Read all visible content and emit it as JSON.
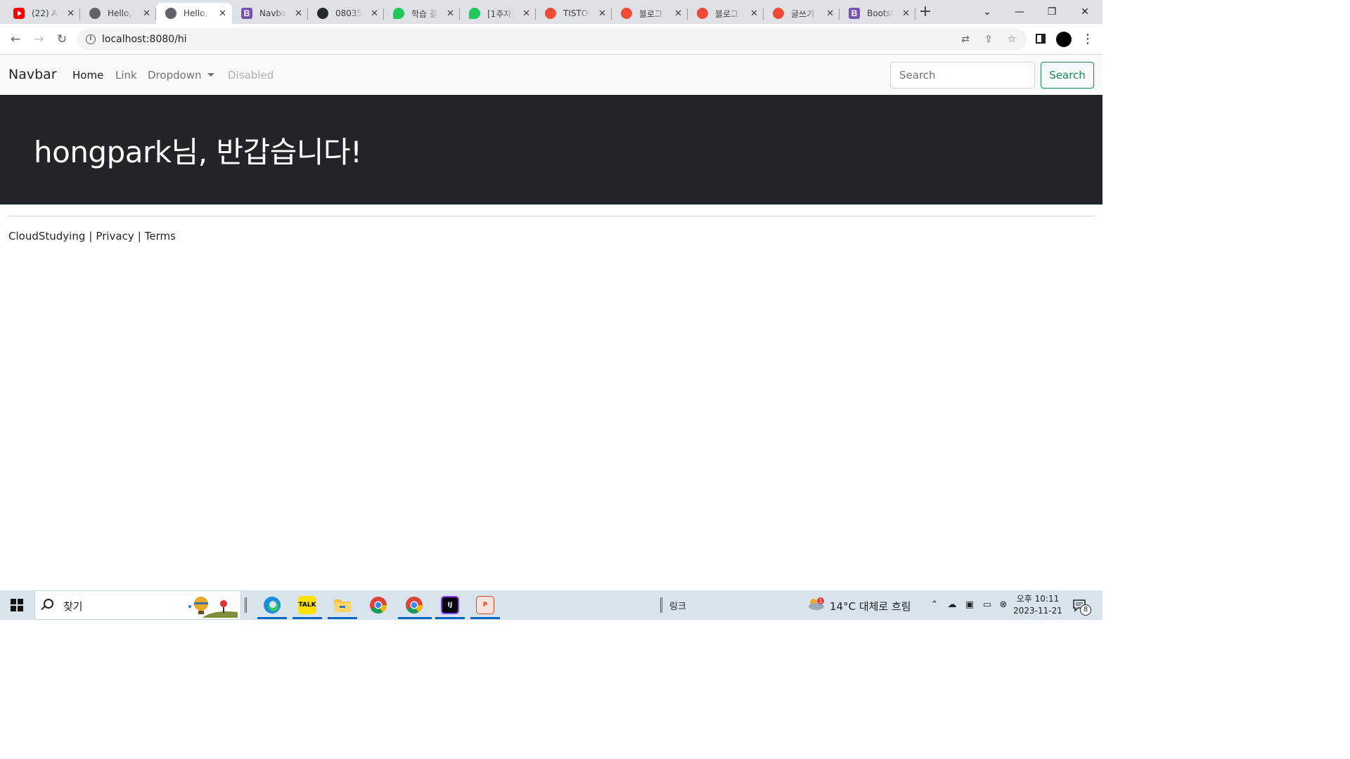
{
  "browser": {
    "tabs": [
      {
        "title": "(22) Ar",
        "favicon": "youtube-icon",
        "active": false
      },
      {
        "title": "Hello, ",
        "favicon": "globe-icon",
        "active": false
      },
      {
        "title": "Hello, ",
        "favicon": "globe-icon",
        "active": true
      },
      {
        "title": "Navbar",
        "favicon": "bootstrap-icon",
        "active": false
      },
      {
        "title": "080354",
        "favicon": "github-icon",
        "active": false
      },
      {
        "title": "학습 결",
        "favicon": "leaf-icon",
        "active": false
      },
      {
        "title": "[1주차]",
        "favicon": "leaf-icon",
        "active": false
      },
      {
        "title": "TISTOR",
        "favicon": "tistory-icon",
        "active": false
      },
      {
        "title": "블로그",
        "favicon": "tistory-icon",
        "active": false
      },
      {
        "title": "블로그",
        "favicon": "tistory-icon",
        "active": false
      },
      {
        "title": "글쓰기",
        "favicon": "tistory-icon",
        "active": false
      },
      {
        "title": "Bootst",
        "favicon": "bootstrap-icon",
        "active": false
      }
    ],
    "url": "localhost:8080/hi"
  },
  "navbar": {
    "brand": "Navbar",
    "links": {
      "home": "Home",
      "link": "Link",
      "dropdown": "Dropdown",
      "disabled": "Disabled"
    },
    "search_placeholder": "Search",
    "search_button": "Search"
  },
  "hero": {
    "greeting": "hongpark님, 반갑습니다!"
  },
  "footer": {
    "brand": "CloudStudying",
    "privacy": "Privacy",
    "terms": "Terms",
    "separator": "|"
  },
  "taskbar": {
    "search_label": "찾기",
    "links_label": "링크",
    "weather": "14°C  대체로 흐림",
    "time": "오후 10:11",
    "date": "2023-11-21",
    "notification_count": "8",
    "weather_badge": "1"
  }
}
